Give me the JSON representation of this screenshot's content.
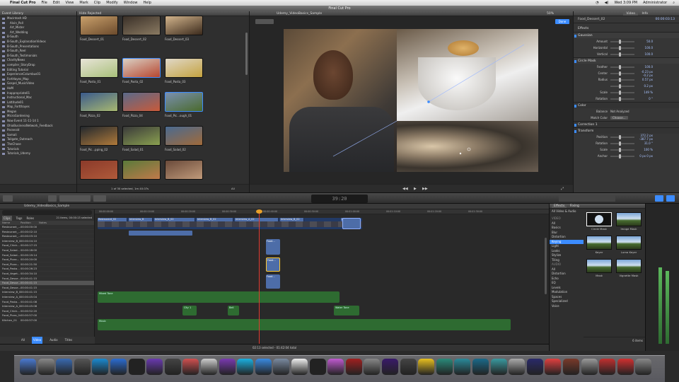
{
  "menubar": {
    "apple": "",
    "app": "Final Cut Pro",
    "items": [
      "File",
      "Edit",
      "View",
      "Mark",
      "Clip",
      "Modify",
      "Window",
      "Help"
    ],
    "clock": "Wed 3:09 PM",
    "user": "Administrator"
  },
  "window_title": "Final Cut Pro",
  "event_library": {
    "title": "Event Library",
    "items": [
      "Macintosh HD",
      "Alvin_Poll",
      "Art_Mister",
      "Art_Wedding",
      "B-South",
      "B-South_ExplanationVideos",
      "B-South_Presentations",
      "B-South_Reel",
      "B-South_Testimonials",
      "CharityNews",
      "compiler_StoryDrop",
      "Editing Tutorial",
      "ExperienceColumbus01",
      "FortHayes_Map",
      "Gospel_MusicVideo",
      "HaM",
      "Inappropriate01",
      "Instructional_Mac",
      "Lattitude01",
      "Map_Fortthayes",
      "Megan",
      "MicroGardening",
      "Now Event 11-11-14 1",
      "OhioBusinessNetwork_Feedback",
      "Paranoid",
      "Somali",
      "Tailgate_Outreach",
      "TheChase",
      "Tutorials",
      "Tutorials_Udemy"
    ],
    "footer": "1 of 30 selected, 1m 40.07s",
    "all_label": "All"
  },
  "browser": {
    "filter": "Hide Rejected",
    "clips": [
      {
        "label": "Food_Dessert_01"
      },
      {
        "label": "Food_Dessert_02"
      },
      {
        "label": "Food_Dessert_03"
      },
      {
        "label": "Food_Pasta_01"
      },
      {
        "label": "Food_Pasta_02"
      },
      {
        "label": "Food_Pasta_03"
      },
      {
        "label": "Food_Pizza_02"
      },
      {
        "label": "Food_Pizza_04"
      },
      {
        "label": "Food_Pic...ough_01"
      },
      {
        "label": "Food_Pic...pping_02"
      },
      {
        "label": "Food_Salad_01"
      },
      {
        "label": "Food_Salad_02"
      },
      {
        "label": ""
      },
      {
        "label": ""
      },
      {
        "label": ""
      }
    ]
  },
  "viewer": {
    "project": "Udemy_VideoBasics_Sample",
    "zoom": "50%",
    "done": "Done"
  },
  "inspector": {
    "tabs": [
      "Video",
      "Info"
    ],
    "clip_name": "Food_Dessert_02",
    "timecode": "00:00:03:13",
    "effects_title": "Effects",
    "gaussian_title": "Gaussian",
    "gaussian_rows": [
      {
        "label": "Amount",
        "value": "50.0"
      },
      {
        "label": "Horizontal",
        "value": "100.0"
      },
      {
        "label": "Vertical",
        "value": "100.0"
      }
    ],
    "circle_mask_title": "Circle Mask",
    "mask_rows": [
      {
        "label": "Feather",
        "value": "100.0"
      },
      {
        "label": "Center",
        "value": "-0.23 px   -0.2 px"
      },
      {
        "label": "Radius",
        "value": "0.57 px"
      },
      {
        "label": "",
        "value": "0.2 px"
      },
      {
        "label": "Scale",
        "value": "149 %"
      },
      {
        "label": "Rotation",
        "value": "0 °"
      }
    ],
    "color_title": "Color",
    "balance_label": "Balance",
    "balance_value": "Not Analyzed",
    "match_label": "Match Color",
    "match_value": "Choose...",
    "correction_title": "Correction 1",
    "transform_title": "Transform",
    "transform_rows": [
      {
        "label": "Position",
        "value": "372.2 px   -387.7 px"
      },
      {
        "label": "Rotation",
        "value": "31.0 °"
      },
      {
        "label": "Scale",
        "value": "100 %"
      },
      {
        "label": "Anchor",
        "value": "0 px   0 px"
      }
    ]
  },
  "toolbar": {
    "timecode": "39:20"
  },
  "timeline": {
    "project": "Udemy_VideoBasics_Sample",
    "index_tabs": [
      "Clips",
      "Tags",
      "Roles"
    ],
    "selection": "21 items, 00:00:13 selected",
    "columns": [
      "Name",
      "Position",
      "Notes"
    ],
    "rows": [
      {
        "name": "Restaurant_...",
        "pos": "00:00:00:00"
      },
      {
        "name": "Restaurant_...",
        "pos": "00:00:02:10"
      },
      {
        "name": "Restaurant_...",
        "pos": "00:00:03:10"
      },
      {
        "name": "Interview_B_02",
        "pos": "00:00:04:10"
      },
      {
        "name": "Food_Chick...",
        "pos": "00:00:17:15"
      },
      {
        "name": "Food_Salad...",
        "pos": "00:00:18:00"
      },
      {
        "name": "Food_Salad...",
        "pos": "00:00:19:14"
      },
      {
        "name": "Food_Pizza...",
        "pos": "00:00:20:00"
      },
      {
        "name": "Food_Pizza...",
        "pos": "00:00:21:50"
      },
      {
        "name": "Food_Pasta...",
        "pos": "00:00:26:23"
      },
      {
        "name": "Food_Veget...",
        "pos": "00:00:34:10"
      },
      {
        "name": "Food_Desse...",
        "pos": "00:00:41:15"
      },
      {
        "name": "Food_Desse...",
        "pos": "00:00:41:15"
      },
      {
        "name": "Food_Desse...",
        "pos": "00:00:41:15"
      },
      {
        "name": "Interview_B_02",
        "pos": "00:00:41:15"
      },
      {
        "name": "Interview_A_02",
        "pos": "00:00:45:04"
      },
      {
        "name": "Food_Pasta...",
        "pos": "00:00:41:08"
      },
      {
        "name": "Interview_A_02",
        "pos": "00:00:45:08"
      },
      {
        "name": "Food_Chick...",
        "pos": "00:00:52:20"
      },
      {
        "name": "Food_Pizza_04",
        "pos": "00:00:57:00"
      },
      {
        "name": "Kitchen_01",
        "pos": "00:00:57:00"
      }
    ],
    "bottom_tabs": [
      "All",
      "Video",
      "Audio",
      "Titles"
    ],
    "ruler": [
      "00:00:00:00",
      "00:00:10:00",
      "00:00:20:00",
      "00:00:30:00",
      "00:00:40:00",
      "00:00:50:00",
      "00:01:00:00",
      "00:01:10:00",
      "00:01:20:00",
      "00:01:30:00"
    ],
    "status": "02:13 selected - 01:42:04 total",
    "storyline_clips": [
      "Restaurant_02",
      "Interview_B",
      "Interview_B_02",
      "Interview_B_02",
      "Interview_A_02",
      "Interview_B_02",
      "Interview"
    ],
    "connected_clips": [
      "Food...",
      "Food...",
      "Food..."
    ],
    "audio_clips": [
      "Mixed Tone",
      "City 1",
      "Bell",
      "Water Tone",
      "Music"
    ]
  },
  "effects_browser": {
    "tabs": [
      "Effects",
      "Fixing"
    ],
    "header": "All Video & Audio",
    "categories": [
      "VIDEO",
      "All",
      "Basics",
      "Blur",
      "Distortion",
      "Keying",
      "Light",
      "Looks",
      "Stylize",
      "Tiling",
      "AUDIO",
      "All",
      "Distortion",
      "Echo",
      "EQ",
      "Levels",
      "Modulation",
      "Spaces",
      "Specialized",
      "Voice"
    ],
    "selected_category": "Keying",
    "tiles": [
      "Circle Mask",
      "Image Mask",
      "Keyer",
      "Luma Keyer",
      "Mask",
      "Vignette Mask"
    ],
    "count": "6 items"
  },
  "colors": {
    "accent": "#3c8cff",
    "clip_blue": "#4d6da8",
    "audio_green": "#3c7a3a",
    "playhead": "#e03a2f"
  }
}
